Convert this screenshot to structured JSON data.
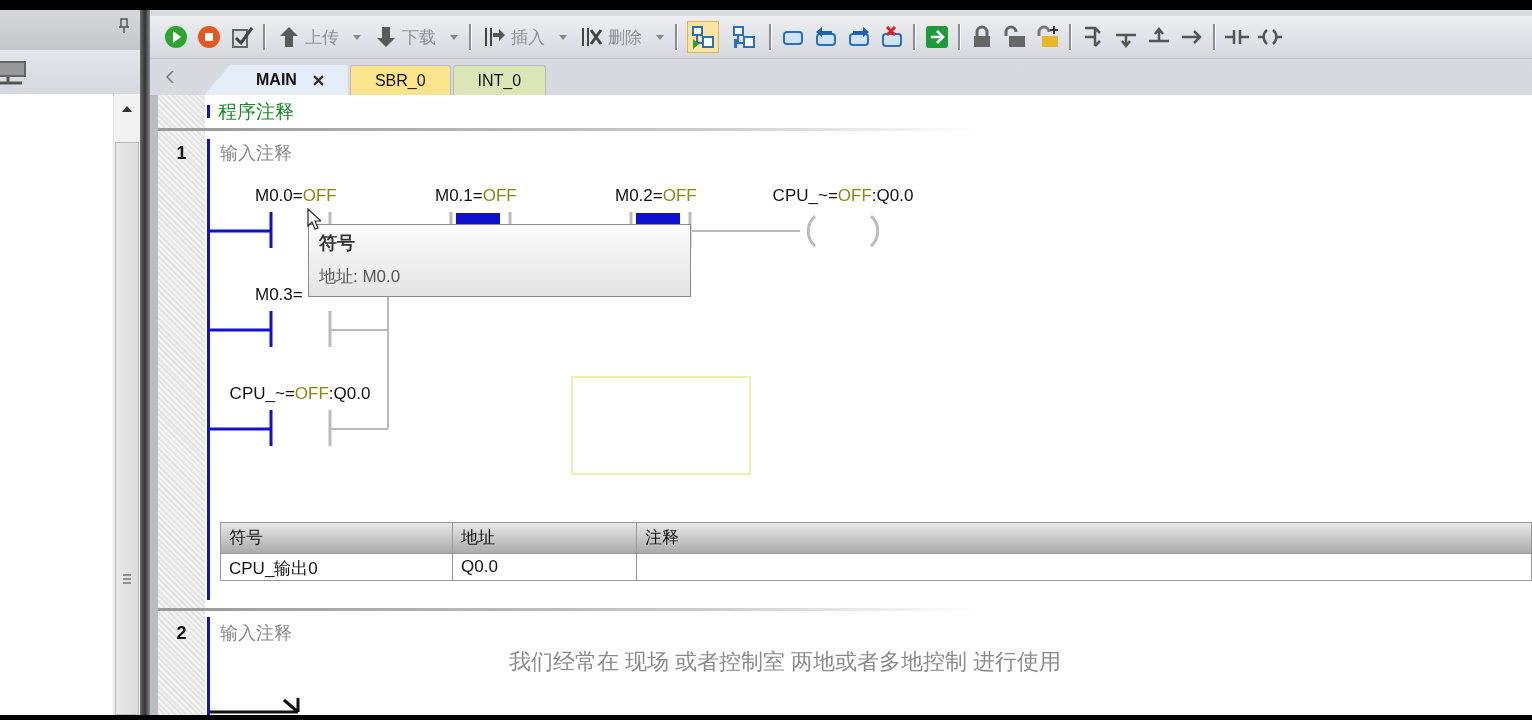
{
  "toolbar": {
    "buttons": [
      {
        "kind": "upload",
        "label": "上传",
        "disabled": true
      },
      {
        "kind": "download",
        "label": "下载",
        "disabled": true
      },
      {
        "kind": "insert",
        "label": "插入",
        "disabled": true
      },
      {
        "kind": "delete",
        "label": "删除",
        "disabled": true
      }
    ],
    "toggles": [
      {
        "selected": true
      },
      {
        "selected": false
      }
    ]
  },
  "tabs": [
    {
      "label": "MAIN",
      "selected": true,
      "color": "#e4ecf7"
    },
    {
      "label": "SBR_0",
      "selected": false,
      "color": "#fbe48c"
    },
    {
      "label": "INT_0",
      "selected": false,
      "color": "#dbe5b5"
    }
  ],
  "program_comment": "程序注释",
  "networks": [
    {
      "number": "1",
      "comment": "输入注释",
      "rungs": [
        {
          "contacts": [
            {
              "name": "M0.0=",
              "value": "OFF",
              "energized": false
            },
            {
              "name": "M0.1=",
              "value": "OFF",
              "energized": true
            },
            {
              "name": "M0.2=",
              "value": "OFF",
              "energized": true
            }
          ],
          "coil": {
            "name": "CPU_~=",
            "value": "OFF",
            "suffix": ":Q0.0"
          }
        },
        {
          "contacts": [
            {
              "name": "M0.3=",
              "energized": false
            }
          ]
        },
        {
          "contacts": [
            {
              "name": "CPU_~=",
              "value": "OFF",
              "suffix": ":Q0.0",
              "energized": false
            }
          ]
        }
      ],
      "symbol_table": {
        "columns": [
          "符号",
          "地址",
          "注释"
        ],
        "rows": [
          [
            "CPU_输出0",
            "Q0.0"
          ]
        ]
      }
    },
    {
      "number": "2",
      "comment": "输入注释"
    }
  ],
  "tooltip": {
    "title": "符号",
    "text": "地址: M0.0"
  },
  "subtitle": "我们经常在 现场 或者控制室 两地或者多地控制 进行使用"
}
